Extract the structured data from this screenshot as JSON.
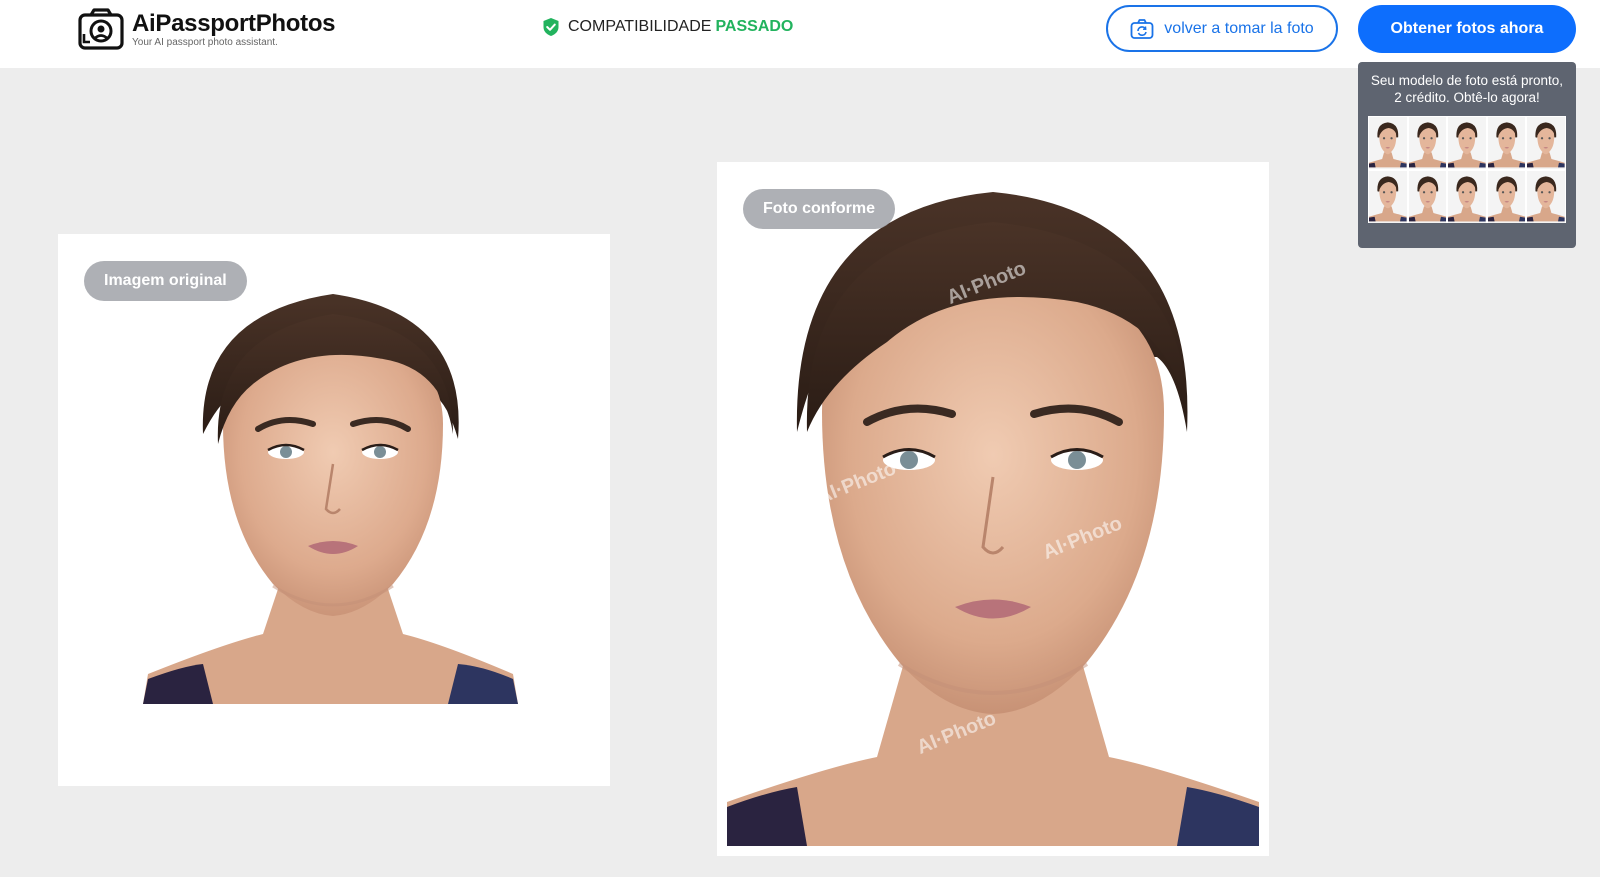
{
  "header": {
    "logo_title": "AiPassportPhotos",
    "logo_tagline": "Your AI passport photo assistant.",
    "compat_label": "COMPATIBILIDADE",
    "compat_status": "PASSADO",
    "retake_label": "volver a tomar la foto",
    "get_photos_label": "Obtener fotos ahora"
  },
  "popup": {
    "message": "Seu modelo de foto está pronto, 2 crédito. Obtê-lo agora!",
    "thumbnail_count": 10
  },
  "original": {
    "badge": "Imagem original"
  },
  "compliant": {
    "badge": "Foto conforme",
    "watermark": "AI·Photo"
  },
  "colors": {
    "accent": "#0d6efd",
    "pass_green": "#22b35e",
    "background": "#ededed",
    "popup_bg": "#5e6470"
  },
  "icons": {
    "logo": "camera-face-icon",
    "compat": "shield-check-icon",
    "retake": "camera-rotate-icon"
  }
}
